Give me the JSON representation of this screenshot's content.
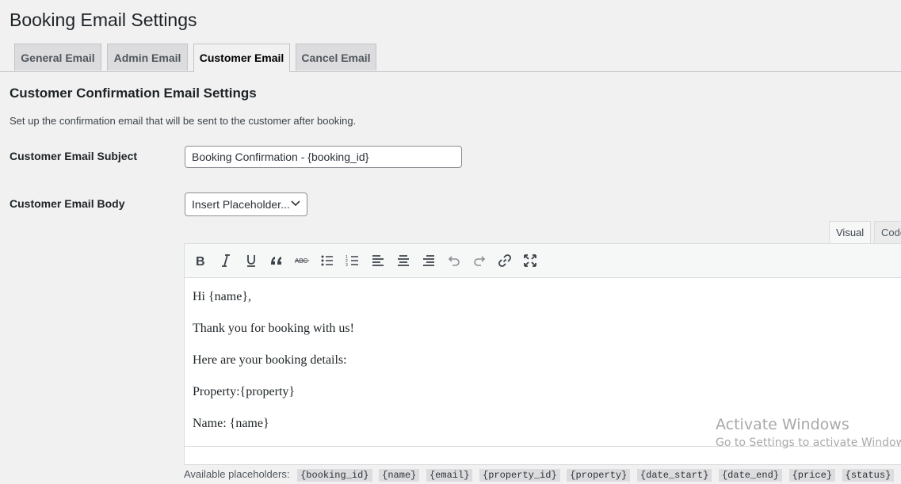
{
  "page": {
    "title": "Booking Email Settings"
  },
  "tabs": [
    {
      "label": "General Email"
    },
    {
      "label": "Admin Email"
    },
    {
      "label": "Customer Email",
      "active": true
    },
    {
      "label": "Cancel Email"
    }
  ],
  "section": {
    "title": "Customer Confirmation Email Settings",
    "description": "Set up the confirmation email that will be sent to the customer after booking."
  },
  "form": {
    "subject_label": "Customer Email Subject",
    "subject_value": "Booking Confirmation - {booking_id}",
    "body_label": "Customer Email Body",
    "insert_placeholder": "Insert Placeholder..."
  },
  "editor": {
    "mode_visual": "Visual",
    "mode_code": "Code",
    "toolbar": [
      "bold-icon",
      "italic-icon",
      "underline-icon",
      "blockquote-icon",
      "strikethrough-icon",
      "bullet-list-icon",
      "numbered-list-icon",
      "align-left-icon",
      "align-center-icon",
      "align-right-icon",
      "undo-icon",
      "redo-icon",
      "link-icon",
      "fullscreen-icon"
    ],
    "lines": [
      "Hi {name},",
      "Thank you for booking with us!",
      "Here are your booking details:",
      "Property:{property}",
      "Name: {name}"
    ]
  },
  "placeholders": {
    "label": "Available placeholders:",
    "items": [
      "{booking_id}",
      "{name}",
      "{email}",
      "{property_id}",
      "{property}",
      "{date_start}",
      "{date_end}",
      "{price}",
      "{status}"
    ]
  },
  "watermark": {
    "line1": "Activate Windows",
    "line2": "Go to Settings to activate Windows."
  }
}
